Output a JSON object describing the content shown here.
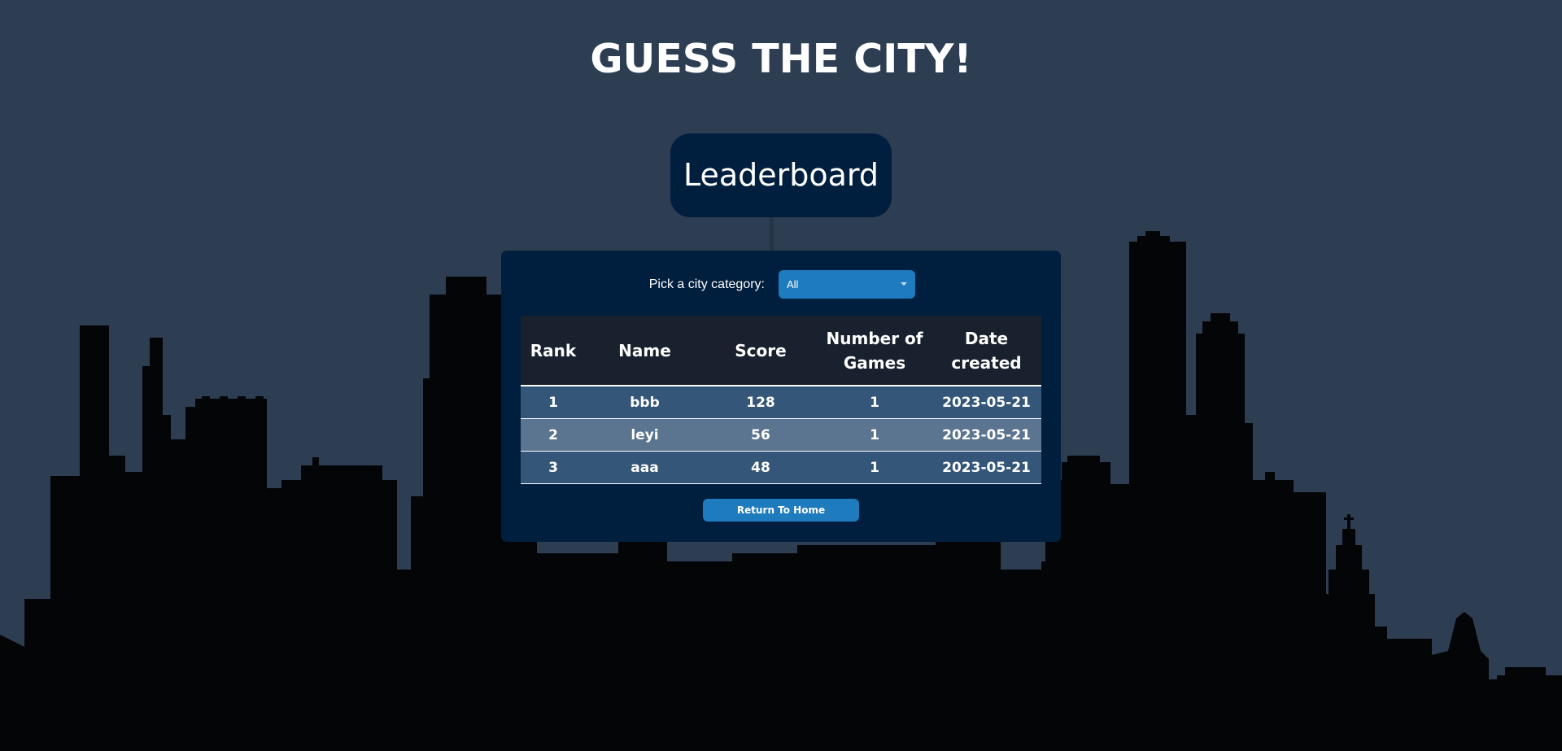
{
  "header": {
    "title": "GUESS THE CITY!"
  },
  "leaderboard": {
    "heading": "Leaderboard"
  },
  "category_picker": {
    "label": "Pick a city category:",
    "selected": "All"
  },
  "table": {
    "headers": {
      "rank": "Rank",
      "name": "Name",
      "score": "Score",
      "games_line1": "Number of",
      "games_line2": "Games",
      "date_line1": "Date",
      "date_line2": "created"
    },
    "rows": [
      {
        "rank": "1",
        "name": "bbb",
        "score": "128",
        "games": "1",
        "date": "2023-05-21"
      },
      {
        "rank": "2",
        "name": "leyi",
        "score": "56",
        "games": "1",
        "date": "2023-05-21"
      },
      {
        "rank": "3",
        "name": "aaa",
        "score": "48",
        "games": "1",
        "date": "2023-05-21"
      }
    ]
  },
  "return_button": {
    "label": "Return To Home"
  },
  "colors": {
    "background": "#2e3e52",
    "skyline": "#030507",
    "panel": "#001f3f",
    "accent_button": "#1e7bbd",
    "table_header": "#18212d",
    "row_odd": "#345679",
    "row_even": "#5b7591"
  }
}
